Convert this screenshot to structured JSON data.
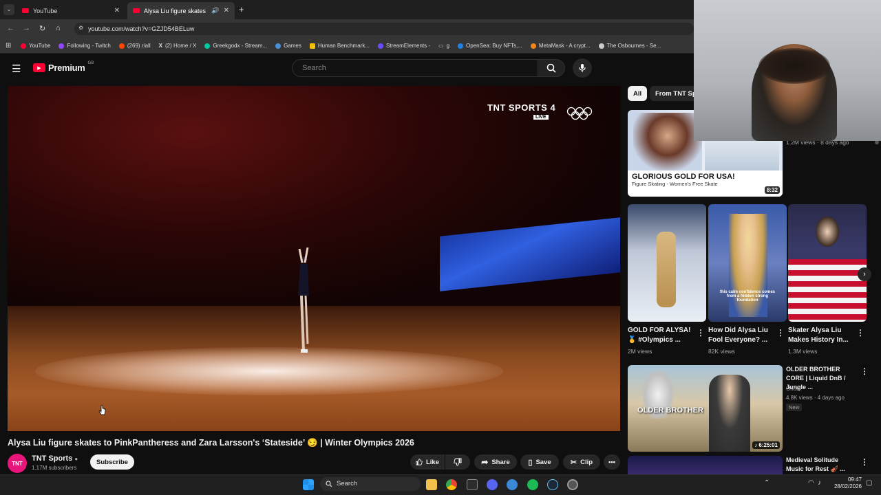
{
  "browser": {
    "tabs": [
      {
        "title": "YouTube",
        "active": false
      },
      {
        "title": "Alysa Liu figure skates to Pi",
        "active": true
      }
    ],
    "url": "youtube.com/watch?v=GZJD54BELuw",
    "bookmarks": [
      {
        "label": "YouTube",
        "color": "#ff0033"
      },
      {
        "label": "Following - Twitch",
        "color": "#9146ff"
      },
      {
        "label": "(269) r/all",
        "color": "#ff4500"
      },
      {
        "label": "(2) Home / X",
        "color": "#ffffff"
      },
      {
        "label": "Greekgodx - Stream...",
        "color": "#00c8a0"
      },
      {
        "label": "Games",
        "color": "#4a90d9"
      },
      {
        "label": "Human Benchmark...",
        "color": "#f5c000"
      },
      {
        "label": "StreamElements -",
        "color": "#6a4cff"
      },
      {
        "label": "g",
        "color": "#888888"
      },
      {
        "label": "OpenSea: Buy NFTs,...",
        "color": "#2081e2"
      },
      {
        "label": "MetaMask - A crypt...",
        "color": "#f6851b"
      },
      {
        "label": "The Osbournes - Se...",
        "color": "#cccccc"
      }
    ]
  },
  "youtube": {
    "logo_text": "Premium",
    "logo_region": "GB",
    "search_placeholder": "Search",
    "overlay": {
      "channel_logo": "TNT SPORTS 4",
      "live": "LIVE"
    },
    "video_title": "Alysa Liu figure skates to PinkPantheress and Zara Larsson's ‘Stateside’ 😏 | Winter Olympics 2026",
    "channel": {
      "name": "TNT Sports",
      "subs": "1.17M subscribers",
      "avatar_text": "TNT"
    },
    "subscribe_label": "Subscribe",
    "actions": {
      "like": "Like",
      "share": "Share",
      "save": "Save",
      "clip": "Clip"
    }
  },
  "sidebar": {
    "chips": [
      "All",
      "From TNT Sp"
    ],
    "featured": {
      "meta": "1.2M views · 8 days ago",
      "duration": "8:32",
      "thumb_caption": "GLORIOUS GOLD FOR USA!",
      "thumb_sub": "Figure Skating - Women's Free Skate"
    },
    "shorts": [
      {
        "title": "GOLD FOR ALYSA! 🥇 #Olympics ...",
        "views": "2M views"
      },
      {
        "title": "How Did Alysa Liu Fool Everyone? ...",
        "views": "82K views"
      },
      {
        "title": "Skater Alysa Liu Makes History In...",
        "views": "1.3M views"
      }
    ],
    "short_caption": "this calm confidence comes from a hidden strong foundation",
    "video2": {
      "title": "OLDER BROTHER CORE | Liquid DnB / Jungle ...",
      "channel": "Orion",
      "meta": "4.8K views · 4 days ago",
      "badge": "New",
      "duration": "6:25:01",
      "thumb_caption": "OLDER BROTHER"
    },
    "video3": {
      "title": "Medieval Solitude Music for Rest 🎻 ..."
    }
  },
  "taskbar": {
    "search": "Search",
    "time": "09:47",
    "date": "28/02/2026"
  }
}
